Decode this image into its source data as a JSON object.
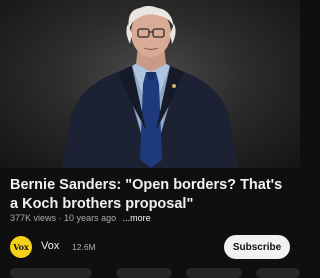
{
  "video": {
    "title": "Bernie Sanders: \"Open borders? That's a Koch brothers proposal\"",
    "views": "377K views",
    "age": "10 years ago",
    "more_label": "...more"
  },
  "channel": {
    "avatar_text": "Vox",
    "name": "Vox",
    "subscribers": "12.6M",
    "subscribe_label": "Subscribe"
  }
}
